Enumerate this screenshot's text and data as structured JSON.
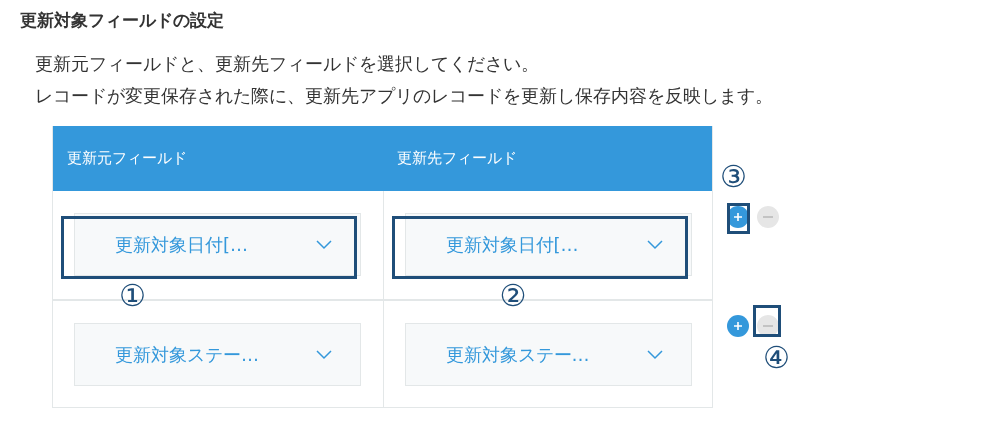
{
  "section_title": "更新対象フィールドの設定",
  "description": [
    "更新元フィールドと、更新先フィールドを選択してください。",
    "レコードが変更保存された際に、更新先アプリのレコードを更新し保存内容を反映します。"
  ],
  "table": {
    "columns": [
      "更新元フィールド",
      "更新先フィールド"
    ],
    "rows": [
      {
        "source": {
          "value": "更新対象日付[…",
          "callout": "①"
        },
        "target": {
          "value": "更新対象日付[…",
          "callout": "②"
        },
        "add": {
          "callout": "③"
        },
        "remove": {
          "disabled": true
        }
      },
      {
        "source": {
          "value": "更新対象ステー…"
        },
        "target": {
          "value": "更新対象ステー…"
        },
        "add": {},
        "remove": {
          "disabled": true,
          "callout": "④"
        }
      }
    ]
  }
}
